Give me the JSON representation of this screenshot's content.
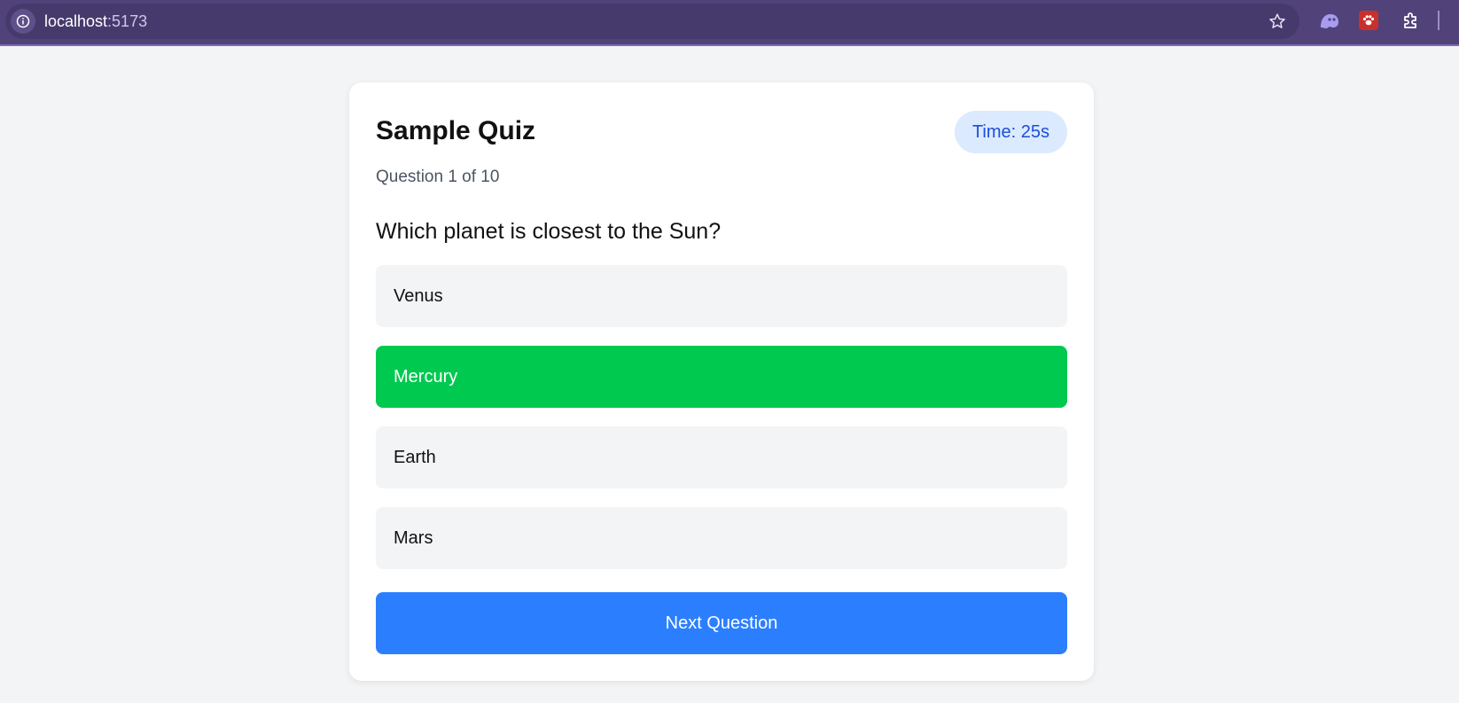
{
  "browser": {
    "url_host": "localhost",
    "url_port": ":5173"
  },
  "quiz": {
    "title": "Sample Quiz",
    "timer_label": "Time: 25s",
    "progress_label": "Question 1 of 10",
    "question": "Which planet is closest to the Sun?",
    "options": [
      {
        "label": "Venus",
        "selected": false
      },
      {
        "label": "Mercury",
        "selected": true
      },
      {
        "label": "Earth",
        "selected": false
      },
      {
        "label": "Mars",
        "selected": false
      }
    ],
    "next_label": "Next Question"
  },
  "colors": {
    "selected_option": "#00c950",
    "primary_button": "#2b7fff",
    "timer_bg": "#dbeafe",
    "timer_text": "#1d4ed8",
    "browser_bar": "#51437a"
  },
  "icons": {
    "address_bar": "info-icon",
    "bookmark": "star-icon",
    "extensions": [
      "ghost-extension-icon",
      "paw-extension-icon",
      "puzzle-extensions-icon"
    ]
  }
}
